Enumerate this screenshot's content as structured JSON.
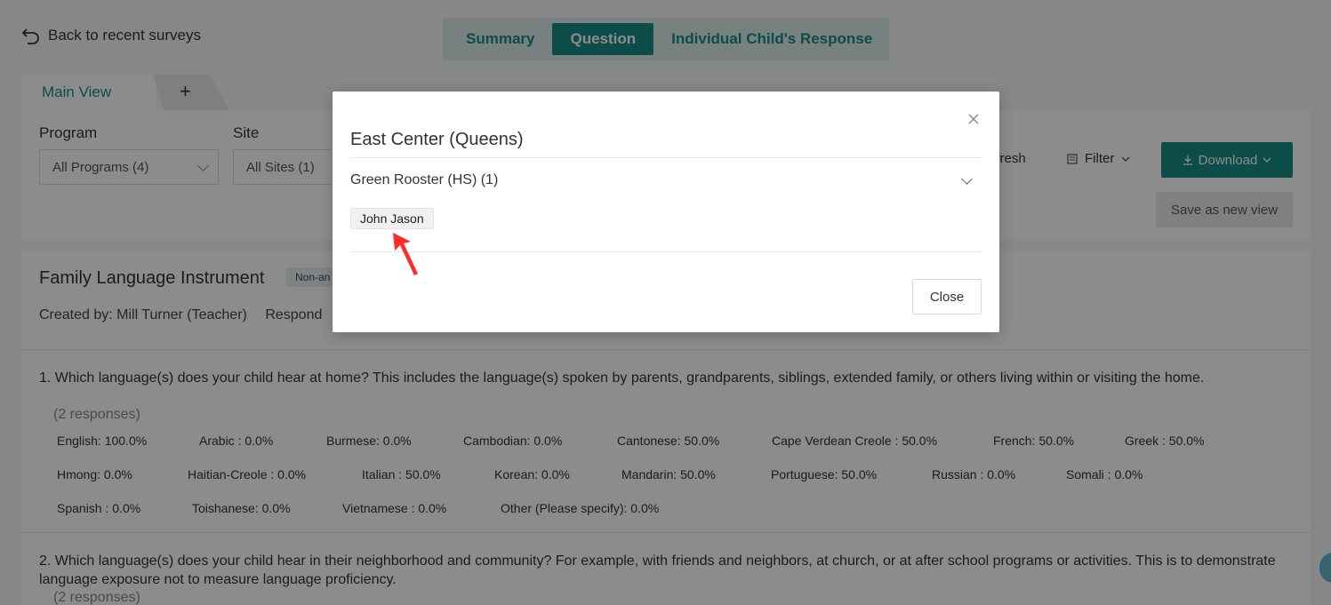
{
  "nav": {
    "back_label": "Back to recent surveys",
    "tabs": [
      {
        "label": "Summary",
        "active": false
      },
      {
        "label": "Question",
        "active": true
      },
      {
        "label": "Individual Child's Response",
        "active": false
      }
    ]
  },
  "views": {
    "main_label": "Main View",
    "add_label": "+"
  },
  "filters": {
    "program_label": "Program",
    "program_value": "All Programs (4)",
    "site_label": "Site",
    "site_value": "All Sites (1)",
    "refresh_label": "efresh",
    "filter_label": "Filter",
    "download_label": "Download",
    "save_view_label": "Save as new view"
  },
  "survey": {
    "title": "Family Language Instrument",
    "badge": "Non-an",
    "created_by": "Created by: Mill Turner (Teacher)",
    "respond": "Respond",
    "questions": [
      {
        "text": "1. Which language(s) does your child hear at home? This includes the language(s) spoken by parents, grandparents, siblings, extended family, or others living within or visiting the home.",
        "responses": "(2 responses)",
        "rows": [
          [
            "English: 100.0%",
            "Arabic : 0.0%",
            "Burmese: 0.0%",
            "Cambodian: 0.0%",
            "Cantonese: 50.0%",
            "Cape Verdean Creole : 50.0%",
            "French: 50.0%",
            "Greek : 50.0%"
          ],
          [
            "Hmong: 0.0%",
            "Haitian-Creole : 0.0%",
            "Italian : 50.0%",
            "Korean: 0.0%",
            "Mandarin: 50.0%",
            "Portuguese: 50.0%",
            "Russian : 0.0%",
            "Somali : 0.0%"
          ],
          [
            "Spanish : 0.0%",
            "Toishanese: 0.0%",
            "Vietnamese : 0.0%",
            "Other (Please specify): 0.0%"
          ]
        ]
      },
      {
        "text": "2. Which language(s) does your child hear in their neighborhood and community? For example, with friends and neighbors, at church, or at after school programs or activities. This is to demonstrate language exposure not to measure language proficiency.",
        "responses": "(2 responses)"
      }
    ]
  },
  "modal": {
    "title": "East Center (Queens)",
    "group_label": "Green Rooster (HS) (1)",
    "child_name": "John Jason",
    "close_label": "Close"
  },
  "colors": {
    "accent": "#178a86",
    "arrow": "#ff2a2a"
  }
}
